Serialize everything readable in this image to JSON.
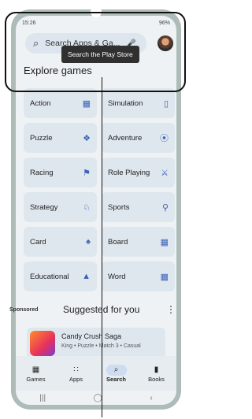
{
  "status": {
    "time": "15:26",
    "battery": "96%"
  },
  "search": {
    "placeholder": "Search Apps & Ga..."
  },
  "section": {
    "title": "Explore games"
  },
  "tooltip": {
    "text": "Search the Play Store"
  },
  "categories": [
    {
      "label": "Action",
      "icon": "gamepad-icon"
    },
    {
      "label": "Simulation",
      "icon": "vr-icon"
    },
    {
      "label": "Puzzle",
      "icon": "puzzle-icon"
    },
    {
      "label": "Adventure",
      "icon": "compass-icon"
    },
    {
      "label": "Racing",
      "icon": "flag-icon"
    },
    {
      "label": "Role Playing",
      "icon": "swords-icon"
    },
    {
      "label": "Strategy",
      "icon": "strategy-icon"
    },
    {
      "label": "Sports",
      "icon": "sports-icon"
    },
    {
      "label": "Card",
      "icon": "cards-icon"
    },
    {
      "label": "Board",
      "icon": "board-icon"
    },
    {
      "label": "Educational",
      "icon": "graduation-cap-icon"
    },
    {
      "label": "Word",
      "icon": "word-tiles-icon"
    }
  ],
  "sponsored": {
    "label": "Sponsored",
    "heading": "Suggested for you"
  },
  "app": {
    "name": "Candy Crush Saga",
    "meta": "King • Puzzle • Match 3 • Casual"
  },
  "nav": [
    {
      "label": "Games",
      "icon": "gamepad-icon",
      "active": false
    },
    {
      "label": "Apps",
      "icon": "apps-grid-icon",
      "active": false
    },
    {
      "label": "Search",
      "icon": "search-icon",
      "active": true
    },
    {
      "label": "Books",
      "icon": "bookmark-icon",
      "active": false
    }
  ],
  "colors": {
    "accent": "#3b63b6",
    "frame": "#aebcb9",
    "highlight": "#111111"
  }
}
